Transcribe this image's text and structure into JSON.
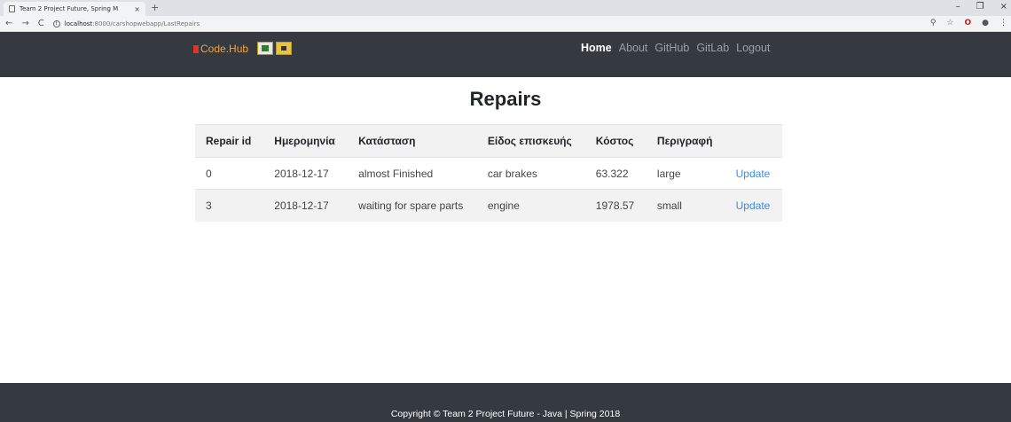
{
  "browser": {
    "tab_title": "Team 2 Project Future, Spring M",
    "tab_close": "×",
    "new_tab": "+",
    "url_host": "localhost",
    "url_path": ":8000/carshopwebapp/LastRepairs",
    "back": "←",
    "forward": "→",
    "reload": "C",
    "minimize": "–",
    "restore": "❐",
    "close": "×"
  },
  "navbar": {
    "brand": "Code.Hub",
    "links": [
      "Home",
      "About",
      "GitHub",
      "GitLab",
      "Logout"
    ],
    "active_index": 0
  },
  "page": {
    "title": "Repairs"
  },
  "table": {
    "headers": [
      "Repair id",
      "Ημερομηνία",
      "Κατάσταση",
      "Είδος επισκευής",
      "Κόστος",
      "Περιγραφή",
      ""
    ],
    "rows": [
      [
        "0",
        "2018-12-17",
        "almost Finished",
        "car brakes",
        "63.322",
        "large",
        "Update"
      ],
      [
        "3",
        "2018-12-17",
        "waiting for spare parts",
        "engine",
        "1978.57",
        "small",
        "Update"
      ]
    ]
  },
  "footer": {
    "text": "Copyright © Team 2 Project Future - Java | Spring 2018"
  },
  "colors": {
    "navbar_bg": "#343a40",
    "link": "#3b8ee0",
    "brand": "#f0a24a"
  }
}
